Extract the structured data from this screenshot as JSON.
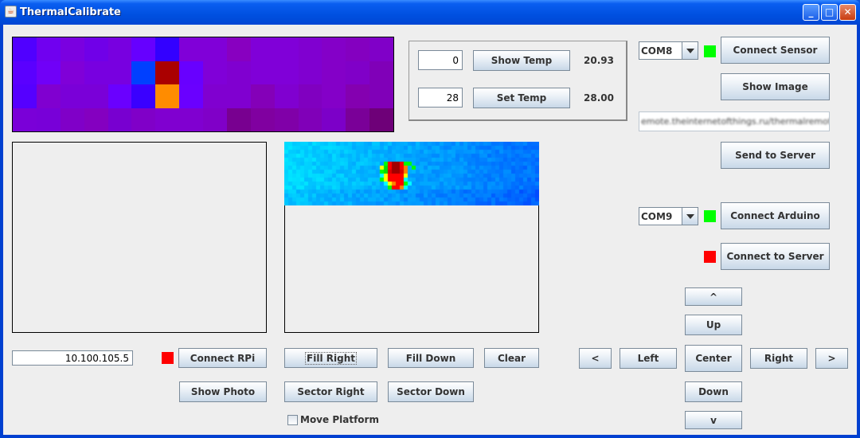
{
  "window": {
    "title": "ThermalCalibrate"
  },
  "colors": {
    "led_green": "#00ff00",
    "led_red": "#ff0000",
    "titlebar": "#0050e0"
  },
  "temp_panel": {
    "show_temp_input": "0",
    "show_temp_button": "Show Temp",
    "show_temp_value": "20.93",
    "set_temp_input": "28",
    "set_temp_button": "Set Temp",
    "set_temp_value": "28.00"
  },
  "sensor": {
    "port": "COM8",
    "status": "green",
    "connect_button": "Connect Sensor",
    "show_image_button": "Show Image"
  },
  "server": {
    "url": "emote.theinternetofthings.ru/thermalremote",
    "send_button": "Send to Server",
    "status": "red",
    "connect_button": "Connect to Server"
  },
  "arduino": {
    "port": "COM9",
    "status": "green",
    "connect_button": "Connect Arduino"
  },
  "rpi": {
    "ip": "10.100.105.5",
    "status": "red",
    "connect_button": "Connect RPi",
    "show_photo_button": "Show Photo"
  },
  "fill": {
    "fill_right": "Fill Right",
    "fill_down": "Fill Down",
    "clear": "Clear",
    "sector_right": "Sector Right",
    "sector_down": "Sector Down",
    "move_platform": "Move Platform",
    "move_platform_checked": false
  },
  "movement": {
    "up_step": "^",
    "up": "Up",
    "left_step": "<",
    "left": "Left",
    "center": "Center",
    "right": "Right",
    "right_step": ">",
    "down": "Down",
    "down_step": "v"
  },
  "sensor_image": {
    "rows": [
      [
        "#5000ff",
        "#7000f0",
        "#7a00e0",
        "#7000e8",
        "#7800e0",
        "#6600ff",
        "#3300ff",
        "#8000d8",
        "#8000d8",
        "#8800c0",
        "#8000d8",
        "#8000d8",
        "#8000d0",
        "#8400c8",
        "#8400c0",
        "#8000c8"
      ],
      [
        "#5a00ff",
        "#7000f8",
        "#8000d8",
        "#7800e0",
        "#7800e0",
        "#0040ff",
        "#aa0000",
        "#6800ff",
        "#8000d8",
        "#8000d0",
        "#8000d8",
        "#8000d8",
        "#8000d0",
        "#8400c8",
        "#8000c8",
        "#8000b8"
      ],
      [
        "#5500ff",
        "#8000d0",
        "#7a00d8",
        "#7a00d8",
        "#6a00ff",
        "#3a00ff",
        "#ff8c00",
        "#6a00ff",
        "#8000d0",
        "#8000d0",
        "#8400b8",
        "#8000d0",
        "#8000c0",
        "#8400c8",
        "#8400b0",
        "#8000b8"
      ],
      [
        "#7a00d8",
        "#7800d8",
        "#8000c8",
        "#8400c0",
        "#7800d0",
        "#8000c8",
        "#8000d0",
        "#8000d0",
        "#8000c8",
        "#780090",
        "#8000a0",
        "#8000a8",
        "#8000b8",
        "#7c00c8",
        "#7a0098",
        "#6e0078"
      ]
    ]
  }
}
